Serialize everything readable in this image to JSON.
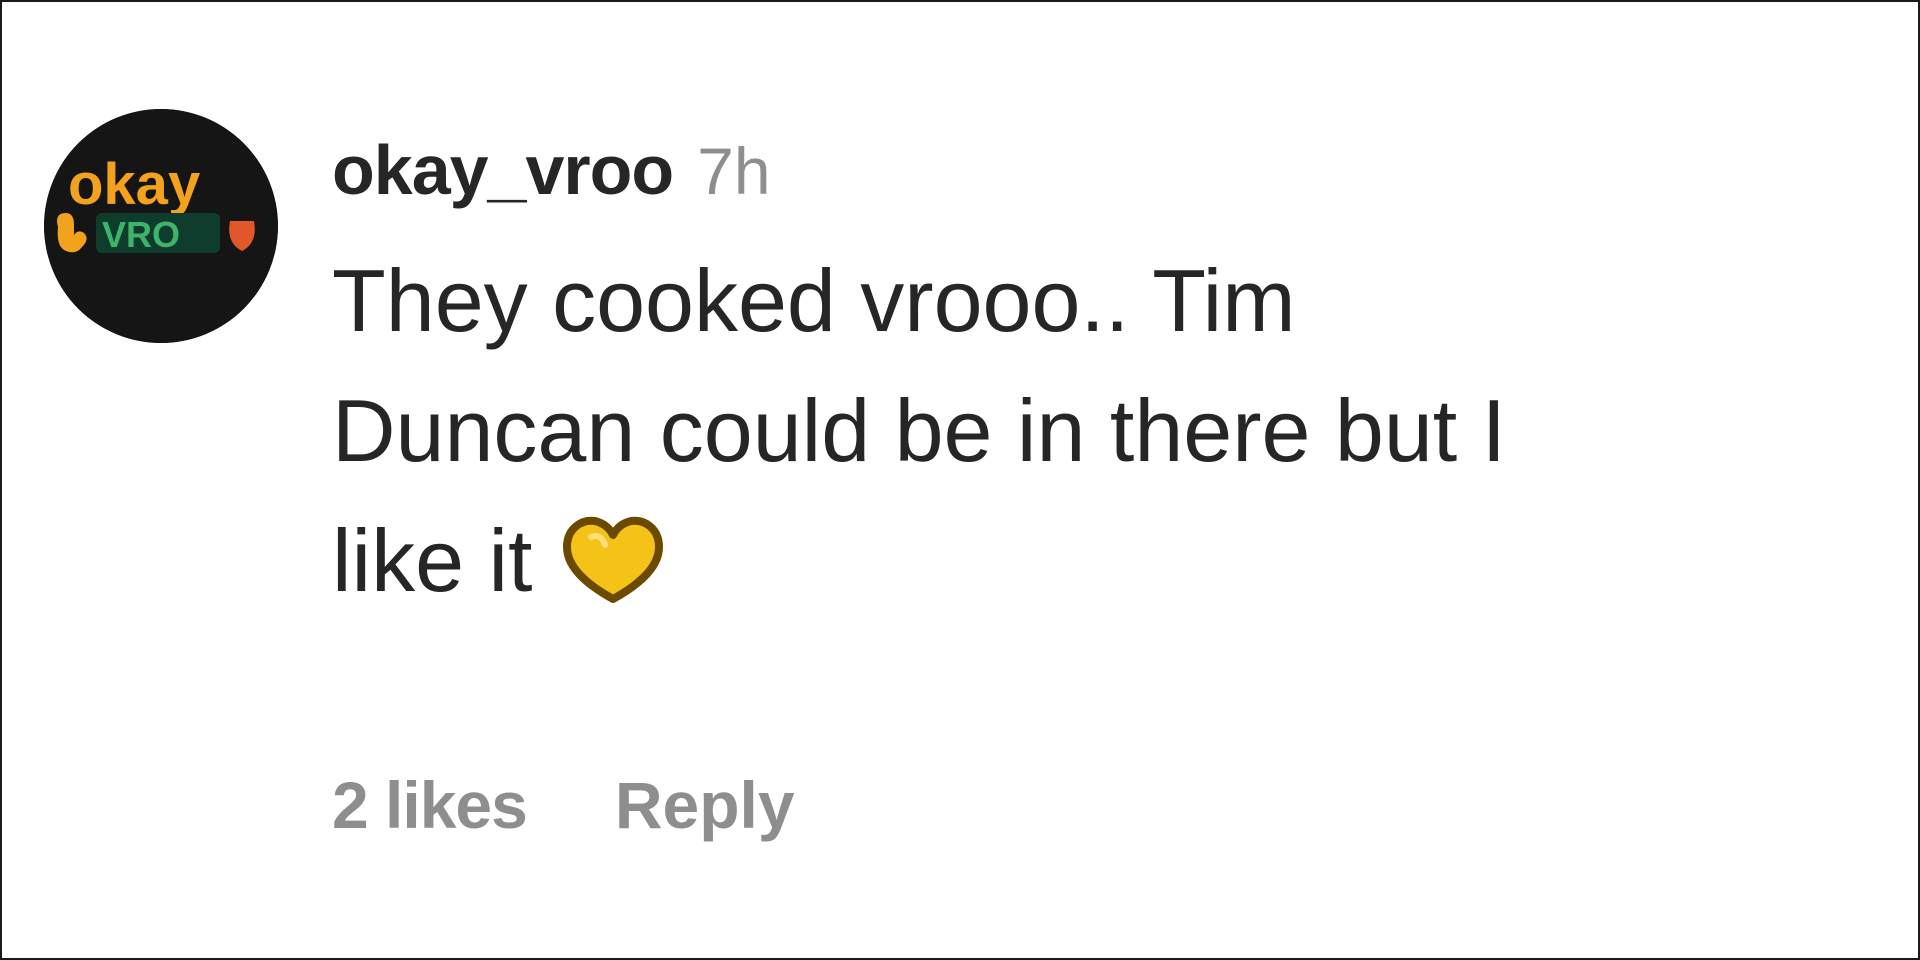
{
  "comment": {
    "avatar": {
      "icon": "okay-vroo-avatar-logo",
      "logo_text_top": "okay",
      "logo_text_bottom": "VRO",
      "background": "#151515",
      "accent": "#f2a21c"
    },
    "username": "okay_vroo",
    "timestamp": "7h",
    "text": "They cooked vrooo.. Tim\nDuncan could be in there but I\nlike it",
    "emoji": {
      "icon": "yellow-heart-emoji",
      "color": "#f5c218"
    },
    "likes_label": "2 likes",
    "reply_label": "Reply"
  },
  "colors": {
    "primary_text": "#262626",
    "secondary_text": "#8e8e8e"
  }
}
